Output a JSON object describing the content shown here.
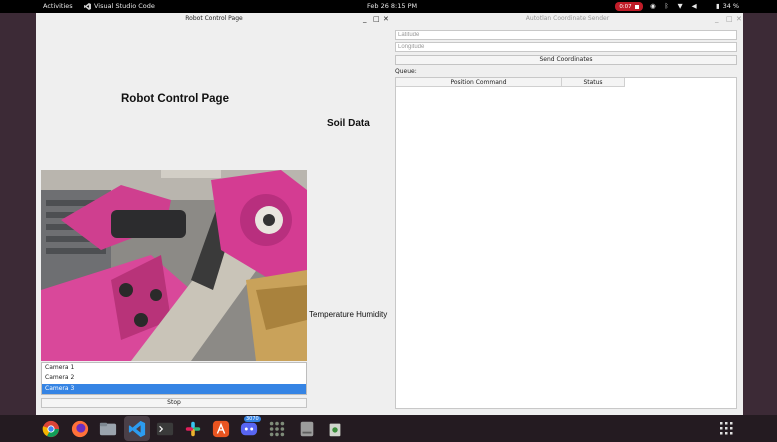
{
  "topbar": {
    "activities": "Activities",
    "app_name": "Visual Studio Code",
    "clock": "Feb 26  8:15 PM",
    "recording": "0:07",
    "battery": "34 %"
  },
  "robot_window": {
    "title": "Robot Control Page",
    "page_heading": "Robot Control Page",
    "soil_label": "Soil Data",
    "temp_humidity_label": "Temperature Humidity",
    "cameras": [
      "Camera 1",
      "Camera 2",
      "Camera 3"
    ],
    "selected_camera": "Camera 3",
    "stop_label": "Stop"
  },
  "coord_window": {
    "title": "Autotlan Coordinate Sender",
    "latitude_placeholder": "Latitude",
    "longitude_placeholder": "Longitude",
    "send_label": "Send Coordinates",
    "queue_label": "Queue:",
    "columns": [
      "Position Command",
      "Status"
    ]
  },
  "dock": {
    "apps": [
      "chrome-icon",
      "firefox-icon",
      "files-icon",
      "vscode-icon",
      "terminal-icon",
      "slack-icon",
      "app-center-icon",
      "discord-icon",
      "settings-icon",
      "disk-icon",
      "trash-icon"
    ],
    "discord_badge": "3070"
  },
  "colors": {
    "selection": "#3584e4",
    "record": "#c01c28",
    "robot_pink": "#d63a8c"
  }
}
